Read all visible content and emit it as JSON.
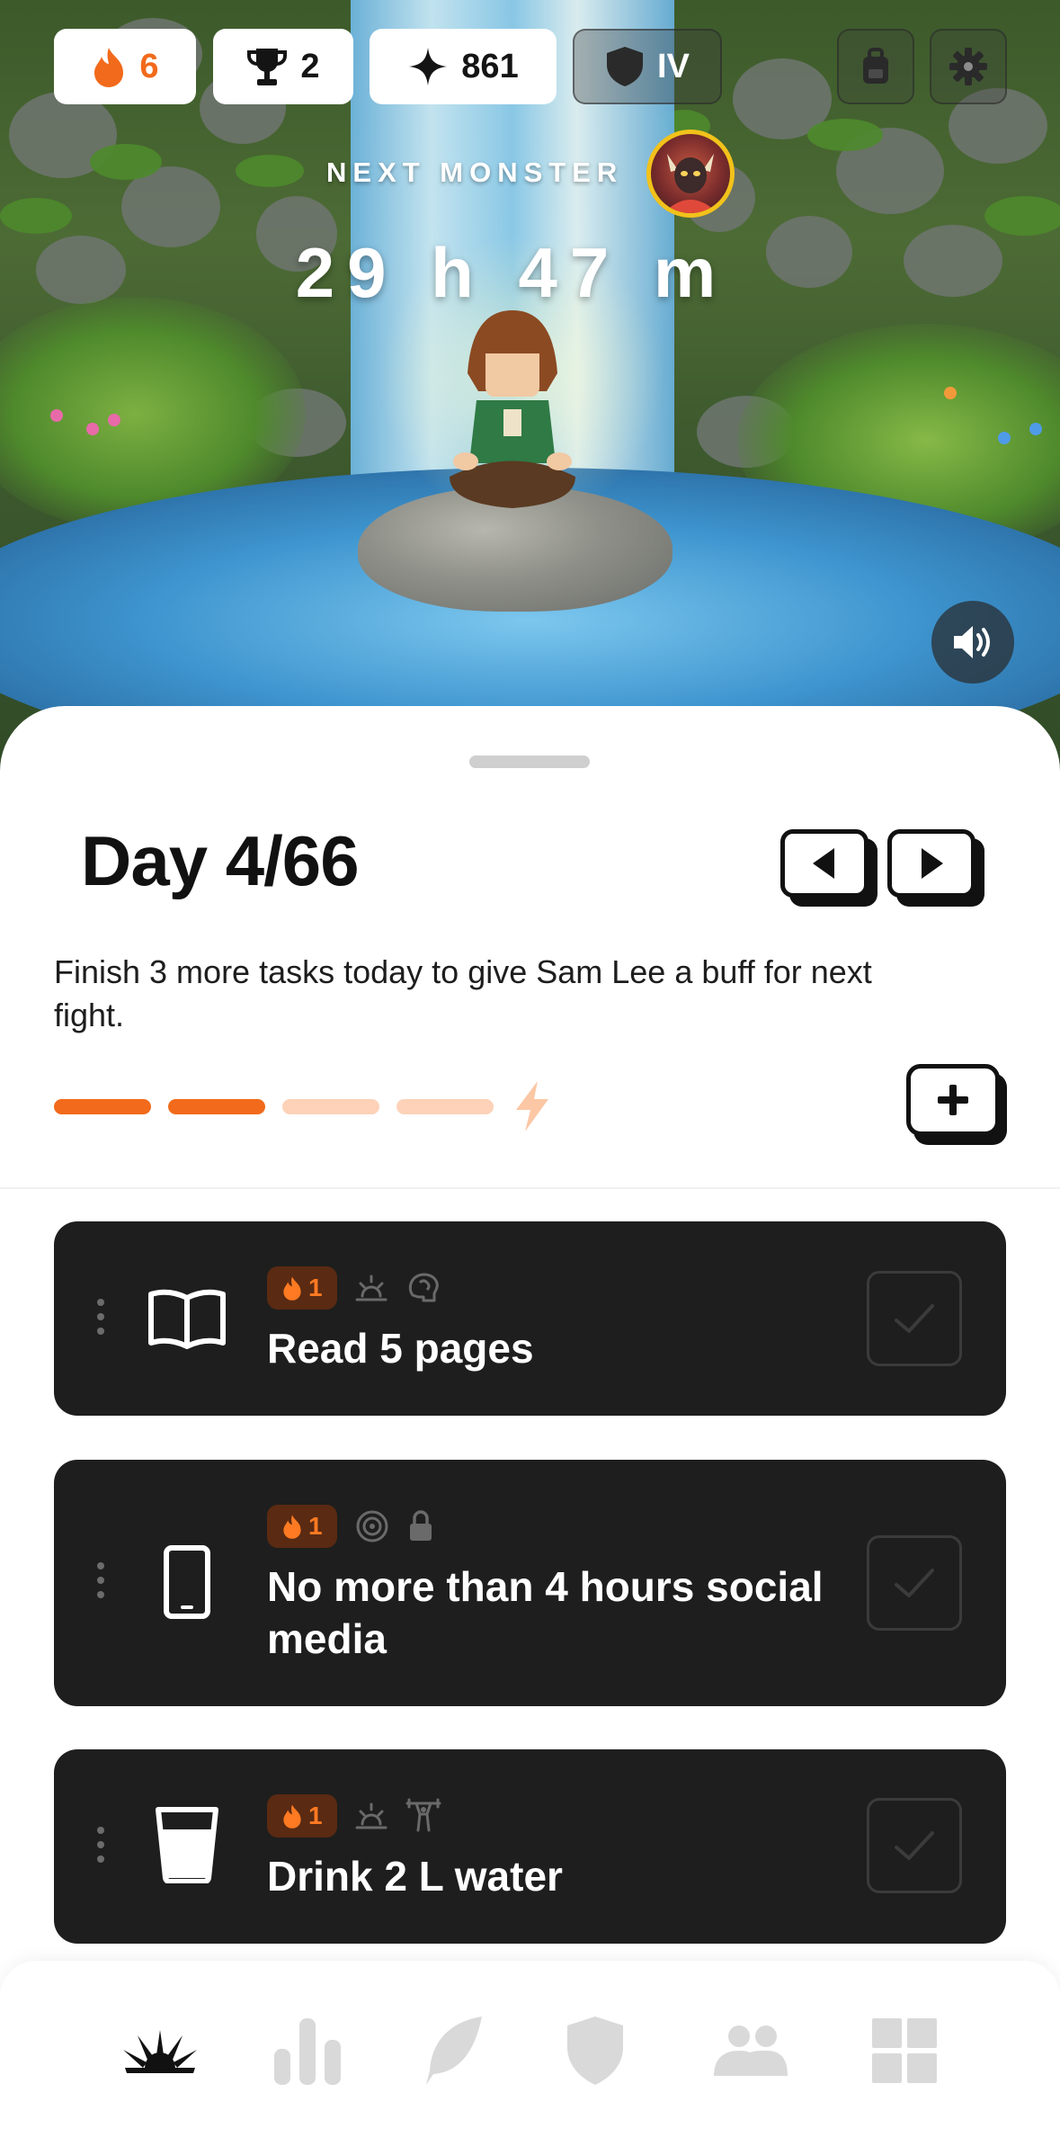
{
  "stats": {
    "streak": "6",
    "trophies": "2",
    "points": "861",
    "rank": "IV"
  },
  "hero": {
    "next_monster_label": "NEXT MONSTER",
    "timer": "29 h 47 m"
  },
  "day": {
    "title": "Day 4/66",
    "description": "Finish 3 more tasks today to give Sam Lee a buff for next fight.",
    "progress_done": 2,
    "progress_total": 4
  },
  "tasks": [
    {
      "title": "Read 5 pages",
      "streak": "1",
      "icon": "book-icon",
      "tags": [
        "sunrise-icon",
        "brain-icon"
      ],
      "completed": false
    },
    {
      "title": "No more than 4 hours social media",
      "streak": "1",
      "icon": "phone-icon",
      "tags": [
        "target-icon",
        "lock-icon"
      ],
      "completed": false
    },
    {
      "title": "Drink 2 L water",
      "streak": "1",
      "icon": "glass-icon",
      "tags": [
        "sunrise-icon",
        "weightlifting-icon"
      ],
      "completed": false
    }
  ],
  "bottom_nav": [
    "home-sunburst-icon",
    "stats-icon",
    "journal-feather-icon",
    "shield-icon",
    "friends-icon",
    "grid-icon"
  ],
  "colors": {
    "accent": "#f26a1b",
    "accent_light": "#fdd2b8",
    "card": "#1e1e1e",
    "monster_ring": "#f2c21b"
  }
}
